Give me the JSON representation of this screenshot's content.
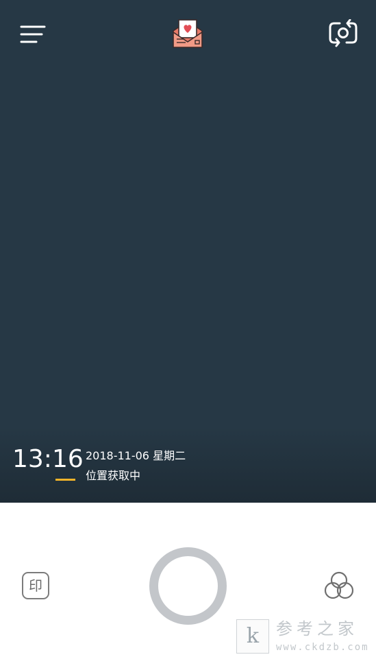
{
  "camera": {
    "time": "13:16",
    "date": "2018-11-06 星期二",
    "location_status": "位置获取中",
    "accent_color": "#f2b32a",
    "background_color": "#263845"
  },
  "toolbar": {
    "menu_icon": "menu-icon",
    "center_icon": "love-letter-envelope-icon",
    "switch_icon": "switch-camera-icon"
  },
  "controls": {
    "stamp_label": "印",
    "shutter_icon": "shutter-ring",
    "filter_icon": "filter-circles-icon"
  },
  "watermark": {
    "logo_letter": "k",
    "title": "参考之家",
    "url": "www.ckdzb.com"
  }
}
